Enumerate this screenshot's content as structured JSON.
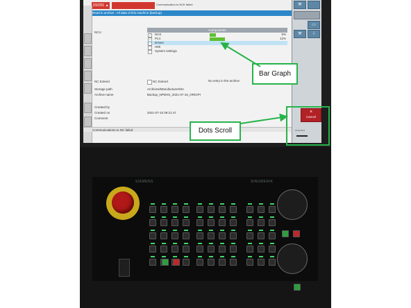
{
  "topbar": {
    "alarm_code": "150201",
    "alarm_marker": "▲",
    "alarm_text": "Communication to NCK failed"
  },
  "title_bar": "Read in archive : All data of this machine (backup)",
  "ncu_label": "NCU",
  "components": {
    "header": "Components",
    "rows": [
      {
        "name": "NCK",
        "checked": true,
        "progress": 5,
        "percent_text": "5%"
      },
      {
        "name": "PLC",
        "checked": true,
        "progress": 12,
        "percent_text": "12%"
      },
      {
        "name": "Drives",
        "checked": false,
        "progress": 0,
        "percent_text": "",
        "highlighted": true
      },
      {
        "name": "HMI",
        "checked": false,
        "progress": 0,
        "percent_text": ""
      },
      {
        "name": "System settings",
        "checked": false,
        "progress": 0,
        "percent_text": ""
      }
    ]
  },
  "fields": {
    "nc_extend_label": "NC Extend",
    "nc_extend_checkbox": "NC Extend",
    "nc_extend_note": "No entry in the archive",
    "storage_path_label": "Storage path",
    "storage_path_value": "Archives/Manufacturer/MA",
    "archive_name_label": "Archive name",
    "archive_name_value": "Backup_NPDHS_2021-07-15_ORIGPI",
    "created_by_label": "Created by",
    "created_on_label": "Created on",
    "created_on_value": "2021-07-15 09:21:47",
    "comment_label": "Comment"
  },
  "status_bar": "Communications to NC failed",
  "softkeys": {
    "cancel_icon": "×",
    "cancel_label": "Cancel",
    "dots": "••••••••"
  },
  "annotations": {
    "bar_graph": "Bar Graph",
    "dots_scroll": "Dots Scroll",
    "accent_color": "#27b34a"
  },
  "panel": {
    "brand_left": "SIEMENS",
    "brand_right": "SINUMERIK"
  }
}
